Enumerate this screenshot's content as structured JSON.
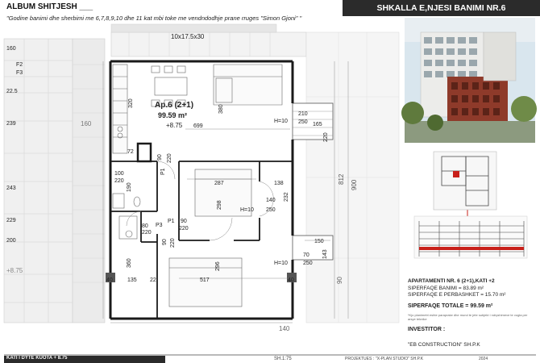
{
  "header": {
    "album_title": "ALBUM SHITJESH ___",
    "section_title": "SHKALLA E,NJESI BANIMI NR.6",
    "subtitle": "\"Godine banimi dhe sherbimi me 6,7,8,9,10 dhe 11 kat mbi toke me vendndodhje prane rruges \"Simon Gjoni\" \""
  },
  "plan": {
    "apartment_label": "Ap.6 (2+1)",
    "apartment_area": "99.59 m²",
    "elevation": "+8.75",
    "elevation_outside": "+8.75",
    "top_label": "10x17.5x30",
    "dims": {
      "d_320": "320",
      "d_380": "380",
      "d_699": "699",
      "d_210": "210",
      "d_250a": "250",
      "d_165": "165",
      "d_h10a": "H=10",
      "d_220a": "220",
      "d_72": "72",
      "d_90a": "90",
      "d_220b": "220",
      "d_p1a": "P1",
      "d_100": "100",
      "d_220c": "220",
      "d_190": "190",
      "d_287": "287",
      "d_138": "138",
      "d_298": "298",
      "d_140": "140",
      "d_h10b": "H=10",
      "d_250b": "250",
      "d_232": "232",
      "d_80": "80",
      "d_220d": "220",
      "d_p3": "P3",
      "d_p1b": "P1",
      "d_90b": "90",
      "d_220e": "220",
      "d_90c": "90",
      "d_220f": "220",
      "d_150": "150",
      "d_143": "143",
      "d_70": "70",
      "d_250c": "250",
      "d_h10c": "H=10",
      "d_360": "360",
      "d_296": "296",
      "d_40a": "40",
      "d_135": "135",
      "d_22": "22",
      "d_517": "517",
      "d_40b": "40",
      "d_812": "812",
      "d_900": "900",
      "d_90d": "90",
      "d_140b": "140",
      "d_160": "160"
    },
    "left_strip": {
      "labels": [
        "160",
        "F2",
        "F3",
        "22.5",
        "239",
        "243",
        "229",
        "200"
      ]
    }
  },
  "info": {
    "apartment_line": "APARTAMENTI NR. 6 (2+1),KATI +2",
    "living_area": "SIPERFAQE BANIMI = 83.89 m²",
    "shared_area": "SIPERFAQE E PERBASHKET = 15.70 m²",
    "total_area": "SIPERFAQE TOTALE = 99.59 m²",
    "note": "*Kjo planimetri eshte paraprake dhe mund te jete subjekt i ndryshimeve te vogla per arsye teknike",
    "investor_label": "INVESTITOR :",
    "investor_name": "\"EB CONSTRUCTION\" SH.P.K"
  },
  "footer": {
    "floor_label": "KATI I DYTE KUOTA + 8.75",
    "sheet_label": "SH.1:75",
    "designer_label": "PROJEKTUES :",
    "designer_name": "\"X-PLAN STUDIO\" SH.P.K",
    "year": "2024"
  },
  "colors": {
    "wall": "#1a1a1a",
    "accent_red": "#c8201a",
    "dark_bar": "#2b2b2b",
    "grid": "#cfcfcf",
    "brick": "#8e3a2a"
  }
}
